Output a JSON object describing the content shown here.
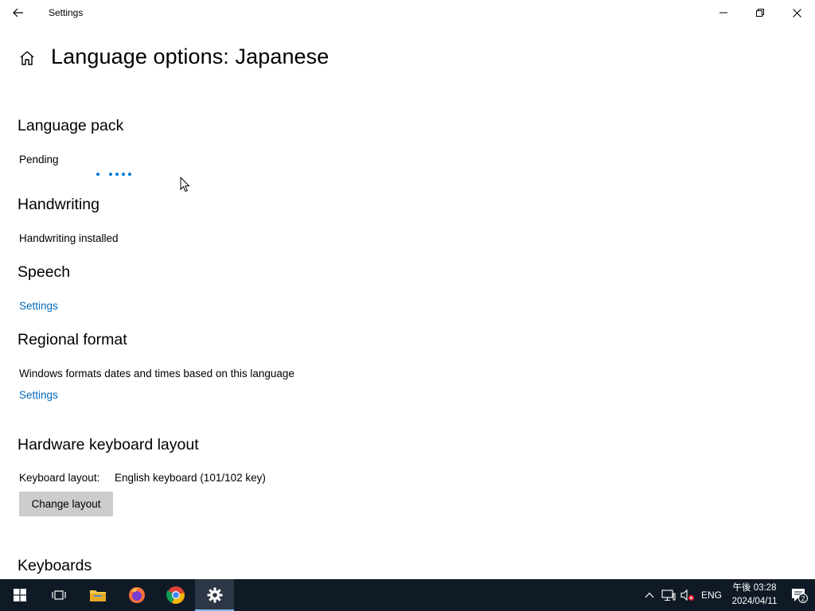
{
  "window": {
    "title": "Settings"
  },
  "page": {
    "title": "Language options: Japanese"
  },
  "sections": {
    "language_pack": {
      "heading": "Language pack",
      "status": "Pending"
    },
    "handwriting": {
      "heading": "Handwriting",
      "status": "Handwriting installed"
    },
    "speech": {
      "heading": "Speech",
      "link": "Settings"
    },
    "regional_format": {
      "heading": "Regional format",
      "description": "Windows formats dates and times based on this language",
      "link": "Settings"
    },
    "hardware_keyboard": {
      "heading": "Hardware keyboard layout",
      "label": "Keyboard layout:",
      "value": "English keyboard (101/102 key)",
      "button": "Change layout"
    },
    "keyboards": {
      "heading": "Keyboards"
    }
  },
  "taskbar": {
    "language": "ENG",
    "time": "午後 03:28",
    "date": "2024/04/11",
    "notification_count": "2",
    "apps": [
      "start-icon",
      "task-view-icon",
      "file-explorer-icon",
      "firefox-icon",
      "chrome-icon",
      "settings-icon"
    ]
  },
  "colors": {
    "accent": "#0078d7",
    "link": "#0067b8",
    "taskbar": "#101a26",
    "button": "#cccccc"
  }
}
